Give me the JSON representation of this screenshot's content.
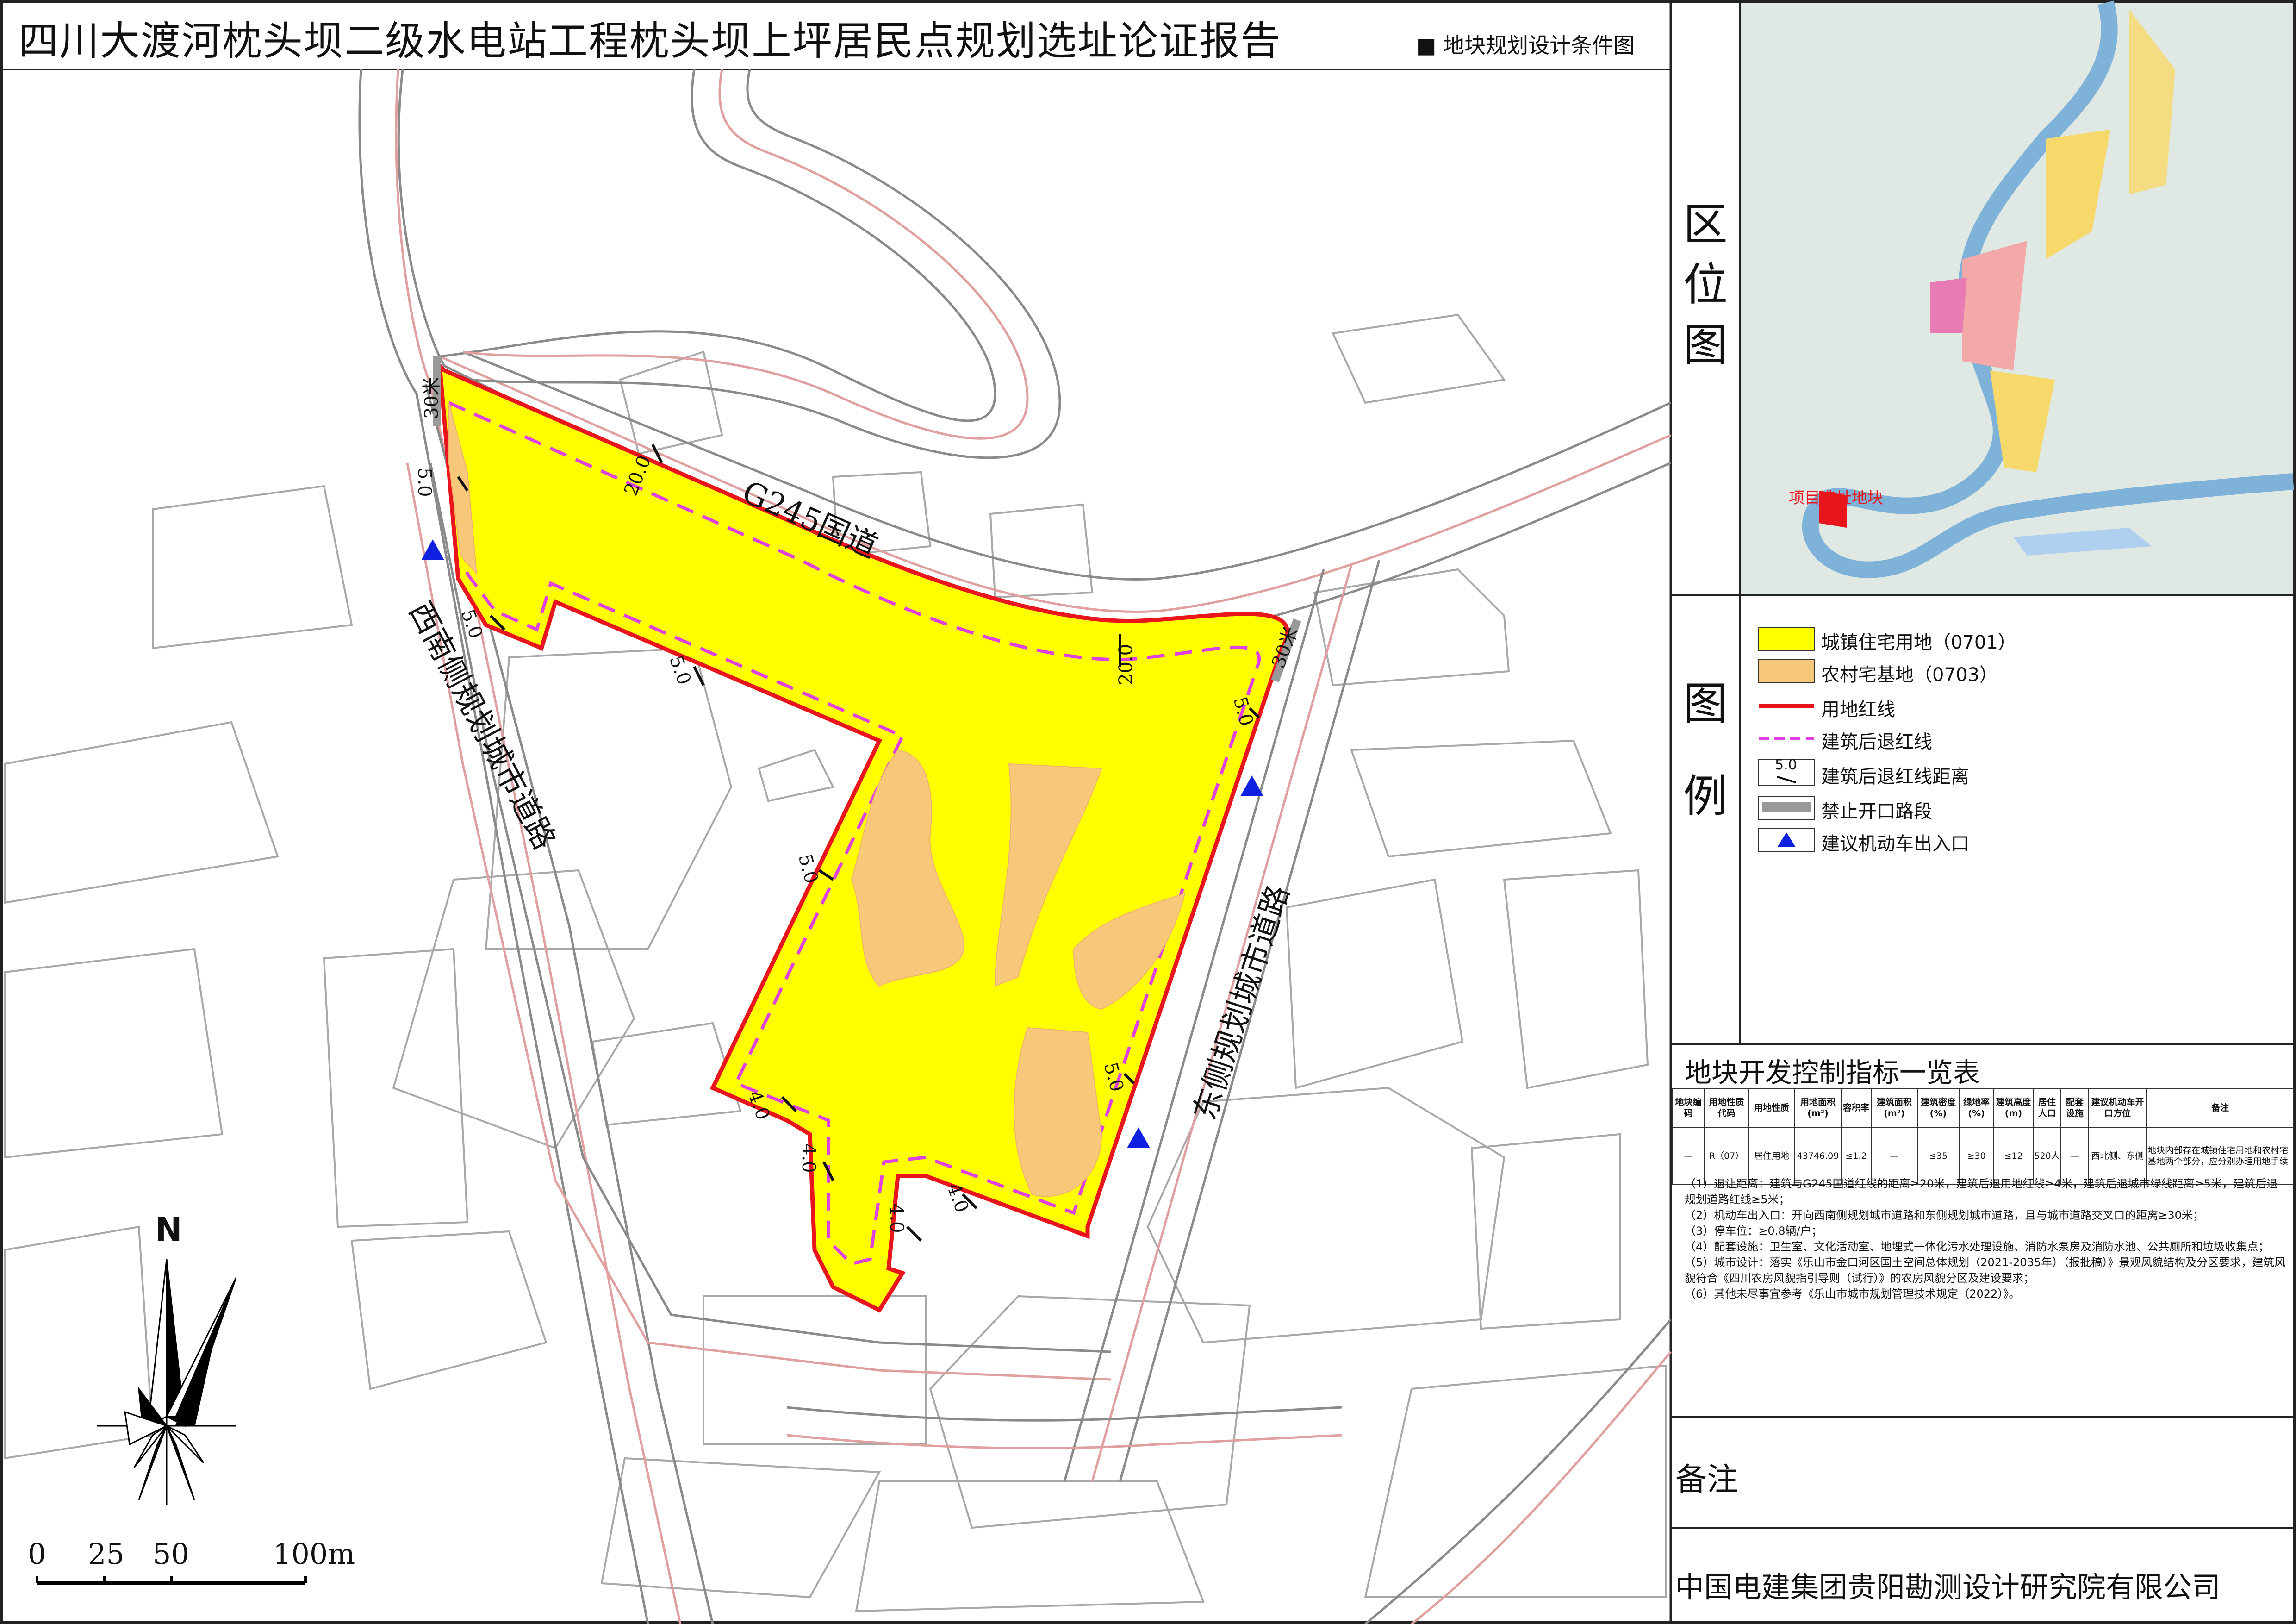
{
  "header": {
    "report_title": "四川大渡河枕头坝二级水电站工程枕头坝上坪居民点规划选址论证报告",
    "sheet_title": "■ 地块规划设计条件图"
  },
  "side_panel": {
    "location_label": [
      "区",
      "位",
      "图"
    ],
    "location_marker": "项目选址地块",
    "legend_label": [
      "图",
      "例"
    ],
    "remark_label": "备注",
    "company": "中国电建集团贵阳勘测设计研究院有限公司"
  },
  "legend": {
    "items": [
      {
        "label": "城镇住宅用地（0701）",
        "icon": "yellow-fill-swatch",
        "color": "#ffff00"
      },
      {
        "label": "农村宅基地（0703）",
        "icon": "orange-fill-swatch",
        "color": "#f8c87a"
      },
      {
        "label": "用地红线",
        "icon": "red-line",
        "color": "#e8161c"
      },
      {
        "label": "建筑后退红线",
        "icon": "magenta-dash-line",
        "color": "#e040e0"
      },
      {
        "label": "建筑后退红线距离",
        "icon": "setback-dimension",
        "sample": "5.0"
      },
      {
        "label": "禁止开口路段",
        "icon": "grey-bar",
        "color": "#999999"
      },
      {
        "label": "建议机动车出入口",
        "icon": "blue-triangle",
        "color": "#1020e0"
      }
    ]
  },
  "control_table": {
    "title": "地块开发控制指标一览表",
    "headers": [
      "地块编码",
      "用地性质代码",
      "用地性质",
      "用地面积(m²)",
      "容积率",
      "建筑面积(m²)",
      "建筑密度(%)",
      "绿地率(%)",
      "建筑高度(m)",
      "居住人口",
      "配套设施",
      "建议机动车开口方位",
      "备注"
    ],
    "row": [
      "—",
      "R（07）",
      "居住用地",
      "43746.09",
      "≤1.2",
      "—",
      "≤35",
      "≥30",
      "≤12",
      "520人",
      "—",
      "西北侧、东侧",
      "地块内部存在城镇住宅用地和农村宅基地两个部分，应分别办理用地手续"
    ]
  },
  "notes": [
    "（1）退让距离：建筑与G245国道红线的距离≥20米，建筑后退用地红线≥4米，建筑后退城市绿线距离≥5米，建筑后退规划道路红线≥5米；",
    "（2）机动车出入口：开向西南侧规划城市道路和东侧规划城市道路，且与城市道路交叉口的距离≥30米；",
    "（3）停车位：≥0.8辆/户；",
    "（4）配套设施：卫生室、文化活动室、地埋式一体化污水处理设施、消防水泵房及消防水池、公共厕所和垃圾收集点；",
    "（5）城市设计：落实《乐山市金口河区国土空间总体规划（2021-2035年）（报批稿）》景观风貌结构及分区要求，建筑风貌符合《四川农房风貌指引导则（试行）》的农房风貌分区及建设要求；",
    "（6）其他未尽事宜参考《乐山市城市规划管理技术规定（2022）》。"
  ],
  "map_labels": {
    "road_g245": "G245国道",
    "road_sw": "西南侧规划城市道路",
    "road_east": "东侧规划城市道路",
    "north": "N",
    "dim_30_left": "30米",
    "dim_30_right": "30米",
    "dim_20_a": "20.0",
    "dim_20_b": "20.0",
    "dim_5_a": "5.0",
    "dim_5_b": "5.0",
    "dim_5_c": "5.0",
    "dim_5_d": "5.0",
    "dim_5_e": "5.0",
    "dim_5_f": "5.0",
    "dim_4_a": "4.0",
    "dim_4_b": "4.0",
    "dim_4_c": "4.0",
    "dim_4_d": "4.0"
  },
  "scale_bar": {
    "labels": [
      "0",
      "25",
      "50",
      "100m"
    ]
  }
}
